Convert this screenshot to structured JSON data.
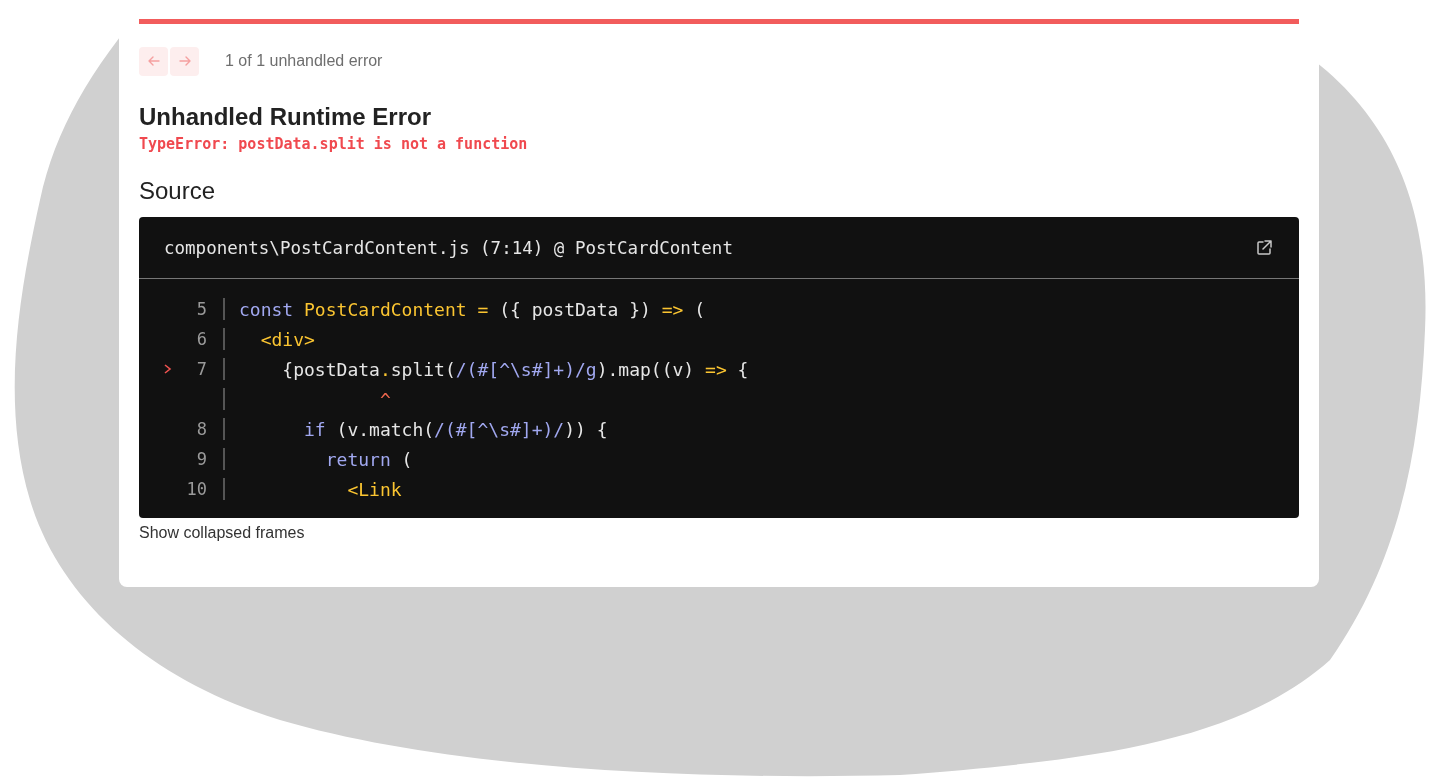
{
  "nav": {
    "prev_disabled": true,
    "next_disabled": true,
    "counter": "1 of 1 unhandled error"
  },
  "title": "Unhandled Runtime Error",
  "message": "TypeError: postData.split is not a function",
  "source_heading": "Source",
  "code_frame": {
    "file": "components\\PostCardContent.js (7:14) @ PostCardContent",
    "lines": [
      {
        "number": "5",
        "highlighted": false,
        "tokens": [
          {
            "text": "const ",
            "kind": "keyword"
          },
          {
            "text": "PostCardContent",
            "kind": "name"
          },
          {
            "text": " = ",
            "kind": "operator"
          },
          {
            "text": "({ postData }) ",
            "kind": "plain"
          },
          {
            "text": "=>",
            "kind": "operator"
          },
          {
            "text": " (",
            "kind": "plain"
          }
        ]
      },
      {
        "number": "6",
        "highlighted": false,
        "tokens": [
          {
            "text": "  <div>",
            "kind": "tag"
          }
        ]
      },
      {
        "number": "7",
        "highlighted": true,
        "tokens": [
          {
            "text": "    {postData",
            "kind": "plain"
          },
          {
            "text": ".",
            "kind": "operator"
          },
          {
            "text": "split(",
            "kind": "plain"
          },
          {
            "text": "/(#[^\\s#]+)/g",
            "kind": "regex"
          },
          {
            "text": ").map((v) ",
            "kind": "plain"
          },
          {
            "text": "=>",
            "kind": "operator"
          },
          {
            "text": " {",
            "kind": "plain"
          }
        ]
      },
      {
        "highlighted": false,
        "tokens": [
          {
            "text": "             ^",
            "kind": "caret"
          }
        ]
      },
      {
        "number": "8",
        "highlighted": false,
        "tokens": [
          {
            "text": "      if",
            "kind": "keyword"
          },
          {
            "text": " (v.match(",
            "kind": "plain"
          },
          {
            "text": "/(#[^\\s#]+)/",
            "kind": "regex"
          },
          {
            "text": ")) {",
            "kind": "plain"
          }
        ]
      },
      {
        "number": "9",
        "highlighted": false,
        "tokens": [
          {
            "text": "        return",
            "kind": "keyword"
          },
          {
            "text": " (",
            "kind": "plain"
          }
        ]
      },
      {
        "number": "10",
        "highlighted": false,
        "tokens": [
          {
            "text": "          <Link",
            "kind": "tag"
          }
        ]
      }
    ]
  },
  "footer_link": "Show collapsed frames"
}
